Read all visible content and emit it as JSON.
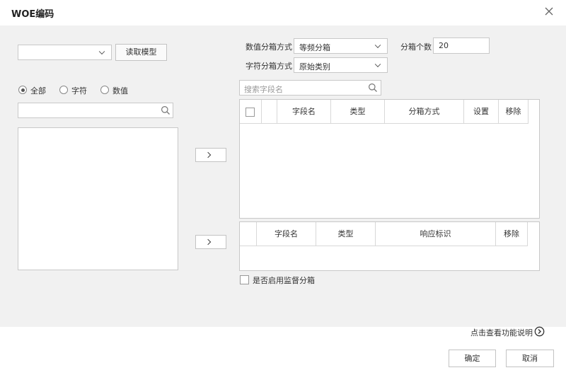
{
  "dialog": {
    "title": "WOE编码",
    "close_icon": "close-icon"
  },
  "left": {
    "model_select_value": "",
    "read_model_label": "读取模型",
    "filters": [
      {
        "label": "全部",
        "checked": true
      },
      {
        "label": "字符",
        "checked": false
      },
      {
        "label": "数值",
        "checked": false
      }
    ],
    "search_placeholder": "",
    "search_icon": "search-icon"
  },
  "binning": {
    "numeric_label": "数值分箱方式",
    "numeric_value": "等频分箱",
    "count_label": "分箱个数",
    "count_value": "20",
    "char_label": "字符分箱方式",
    "char_value": "原始类别"
  },
  "right": {
    "field_search_placeholder": "搜索字段名",
    "feature_table": {
      "columns": [
        "字段名",
        "类型",
        "分箱方式",
        "设置",
        "移除"
      ]
    },
    "target_table": {
      "columns": [
        "字段名",
        "类型",
        "响应标识",
        "移除"
      ]
    },
    "supervised_label": "是否启用监督分箱",
    "supervised_checked": false
  },
  "footer": {
    "help_link": "点击查看功能说明",
    "help_icon": "chevron-right-circle-icon",
    "ok_label": "确定",
    "cancel_label": "取消"
  }
}
